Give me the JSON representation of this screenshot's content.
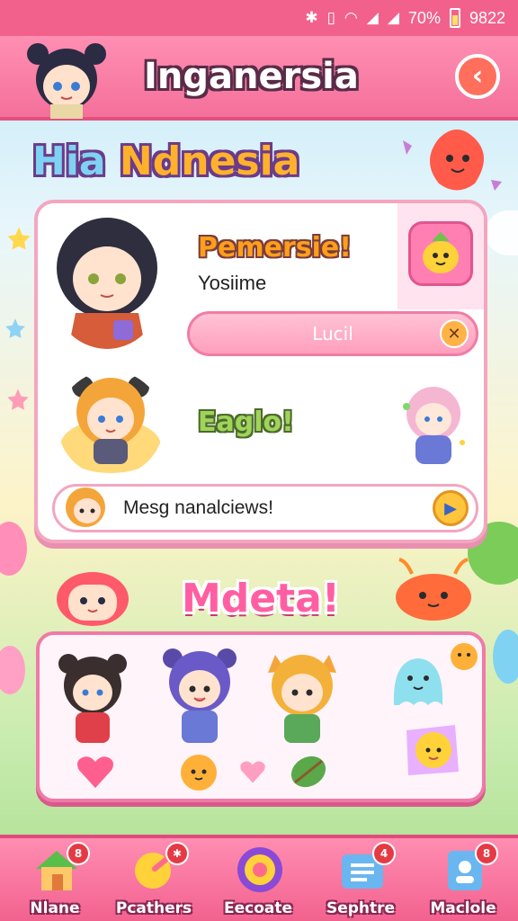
{
  "status_bar": {
    "battery": "70%",
    "clock": "9822"
  },
  "header": {
    "title": "Inganersia",
    "back_icon": "back-arrow-icon"
  },
  "sections": {
    "title_part_a": "Hia ",
    "title_part_b": "Ndnesia",
    "gallery_title": "Mdeta!"
  },
  "card": {
    "headline1": "Pemersie!",
    "subline1": "Yosiime",
    "input_value": "Lucil",
    "headline2": "Eaglo!",
    "message": "Mesg nanalciews!"
  },
  "nav": [
    {
      "label": "Nlane",
      "badge": "8",
      "icon": "home-icon"
    },
    {
      "label": "Pcathers",
      "badge": "✱",
      "icon": "feather-icon"
    },
    {
      "label": "Eecoate",
      "badge": "",
      "icon": "target-icon"
    },
    {
      "label": "Sephtre",
      "badge": "4",
      "icon": "mailbox-icon"
    },
    {
      "label": "Maclole",
      "badge": "8",
      "icon": "profile-card-icon"
    }
  ],
  "colors": {
    "primary_pink": "#f2618c",
    "accent_orange": "#ff9e1b",
    "accent_green": "#9fd45a",
    "accent_blue": "#7fd2f2"
  }
}
